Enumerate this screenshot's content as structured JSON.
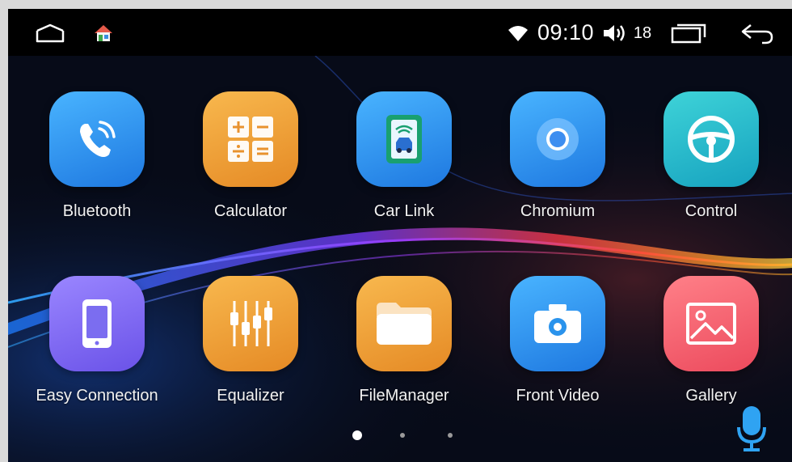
{
  "status_bar": {
    "time": "09:10",
    "volume_level": "18",
    "icons": {
      "home": "home-outline-icon",
      "launcher": "house-color-icon",
      "wifi": "wifi-icon",
      "volume": "volume-icon",
      "recents": "recent-apps-icon",
      "back": "back-arrow-icon"
    }
  },
  "apps": [
    {
      "label": "Bluetooth",
      "icon": "bluetooth-phone-icon",
      "color": "#2a93ec"
    },
    {
      "label": "Calculator",
      "icon": "calculator-icon",
      "color": "#e8922e"
    },
    {
      "label": "Car Link",
      "icon": "car-link-icon",
      "color": "#2a93ec"
    },
    {
      "label": "Chromium",
      "icon": "chromium-icon",
      "color": "#2a93ec"
    },
    {
      "label": "Control",
      "icon": "steering-wheel-icon",
      "color": "#22b9c8"
    },
    {
      "label": "Easy Connection",
      "icon": "phone-device-icon",
      "color": "#7b6df0"
    },
    {
      "label": "Equalizer",
      "icon": "equalizer-icon",
      "color": "#e8922e"
    },
    {
      "label": "FileManager",
      "icon": "folder-icon",
      "color": "#e8922e"
    },
    {
      "label": "Front Video",
      "icon": "camera-icon",
      "color": "#2a93ec"
    },
    {
      "label": "Gallery",
      "icon": "gallery-icon",
      "color": "#ee5a6a"
    }
  ],
  "pager": {
    "current_page": 1,
    "total_pages": 3
  },
  "voice": {
    "icon": "microphone-icon"
  }
}
